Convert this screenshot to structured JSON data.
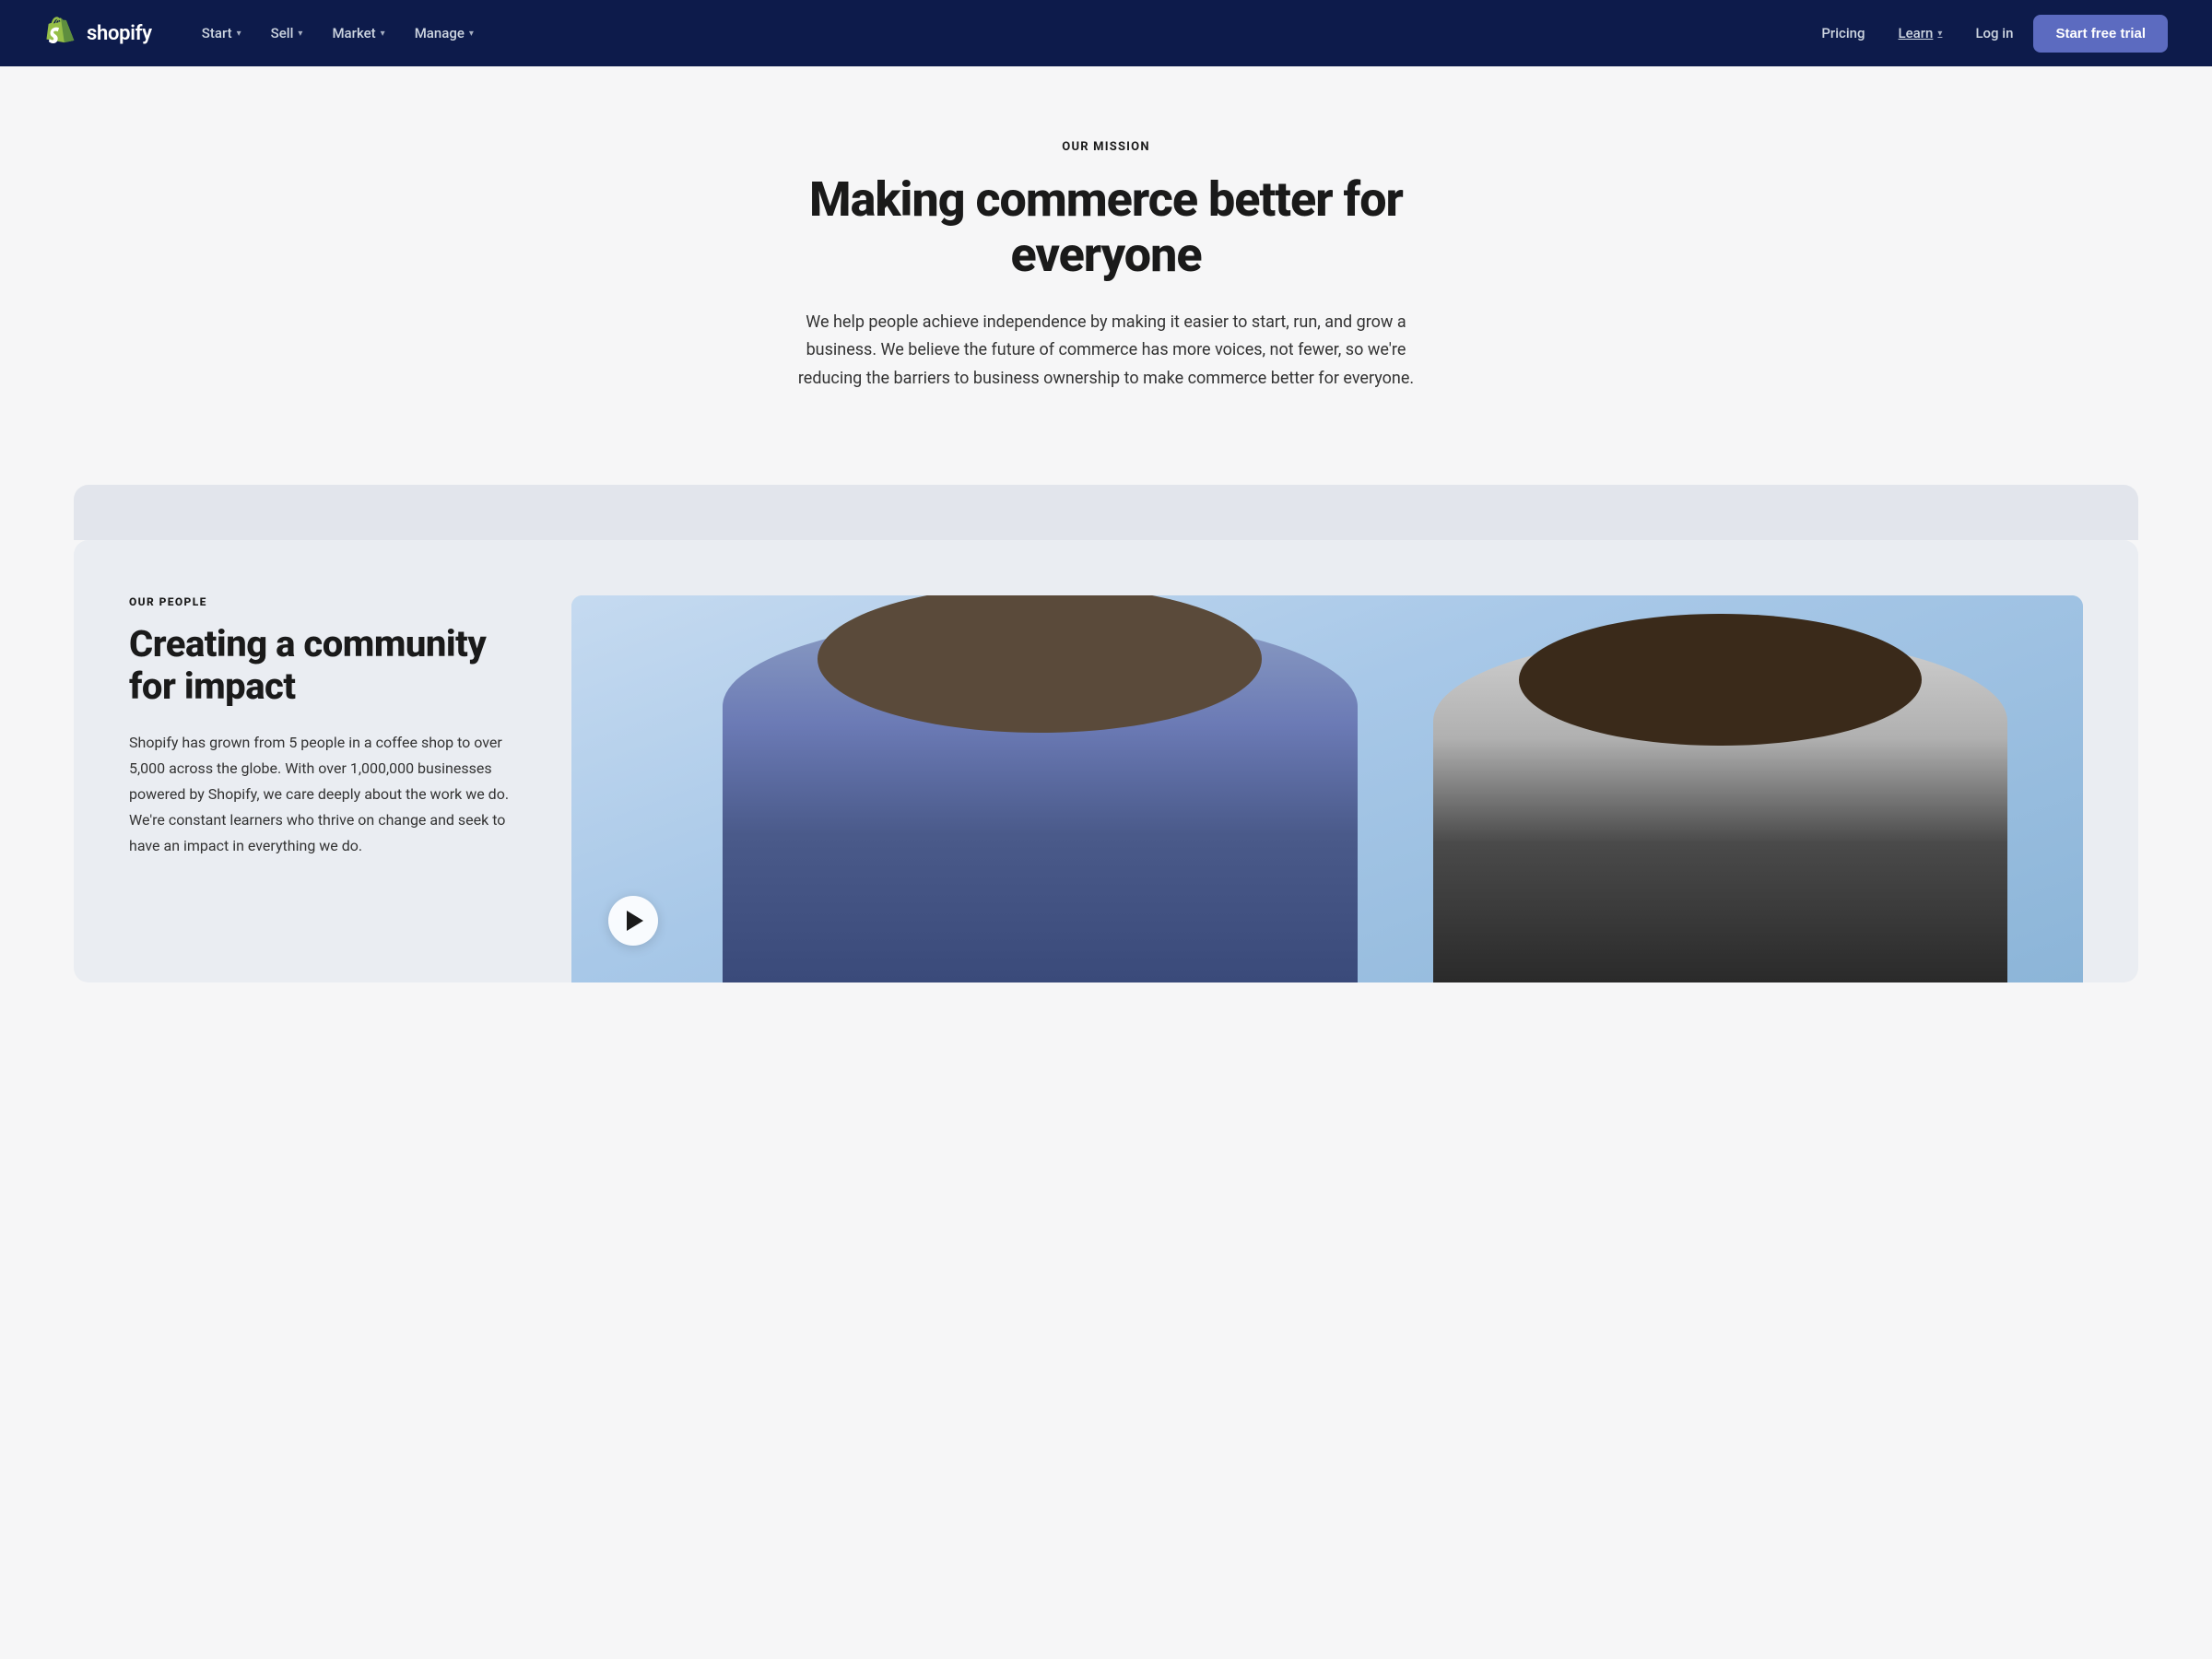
{
  "nav": {
    "logo_text": "shopify",
    "links": [
      {
        "label": "Start",
        "has_dropdown": true
      },
      {
        "label": "Sell",
        "has_dropdown": true
      },
      {
        "label": "Market",
        "has_dropdown": true
      },
      {
        "label": "Manage",
        "has_dropdown": true
      }
    ],
    "right_links": [
      {
        "label": "Pricing",
        "has_dropdown": false
      },
      {
        "label": "Learn",
        "has_dropdown": true
      },
      {
        "label": "Log in",
        "has_dropdown": false
      }
    ],
    "cta_label": "Start free trial"
  },
  "hero": {
    "eyebrow": "OUR MISSION",
    "title": "Making commerce better for everyone",
    "subtitle": "We help people achieve independence by making it easier to start, run, and grow a business. We believe the future of commerce has more voices, not fewer, so we're reducing the barriers to business ownership to make commerce better for everyone."
  },
  "people": {
    "eyebrow": "OUR PEOPLE",
    "title": "Creating a community for impact",
    "body": "Shopify has grown from 5 people in a coffee shop to over 5,000 across the globe. With over 1,000,000 businesses powered by Shopify, we care deeply about the work we do. We're constant learners who thrive on change and seek to have an impact in everything we do.",
    "play_button_label": "Play video"
  }
}
